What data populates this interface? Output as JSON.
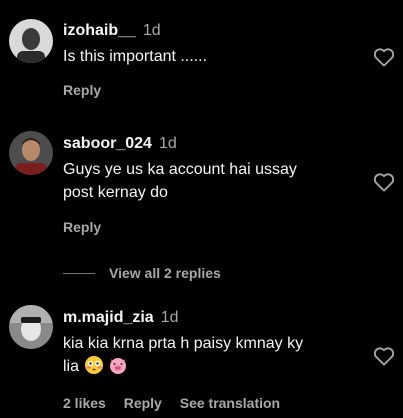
{
  "comments": [
    {
      "username": "izohaib__",
      "time": "1d",
      "text": "Is this important ......",
      "reply_label": "Reply"
    },
    {
      "username": "saboor_024",
      "time": "1d",
      "text_line1": "Guys ye us ka account hai ussay",
      "text_line2": "post kernay do",
      "reply_label": "Reply"
    },
    {
      "username": "m.majid_zia",
      "time": "1d",
      "text_line1": "kia kia krna prta h paisy kmnay ky",
      "text_line2": "lia",
      "emojis": [
        "flushed-face-emoji",
        "pig-face-emoji"
      ],
      "likes_label": "2 likes",
      "reply_label": "Reply",
      "translate_label": "See translation"
    }
  ],
  "view_replies_label": "View all 2 replies",
  "icons": {
    "like": "heart-outline-icon"
  },
  "colors": {
    "background": "#000000",
    "primary_text": "#f5f5f5",
    "secondary_text": "#a8a8a8"
  }
}
